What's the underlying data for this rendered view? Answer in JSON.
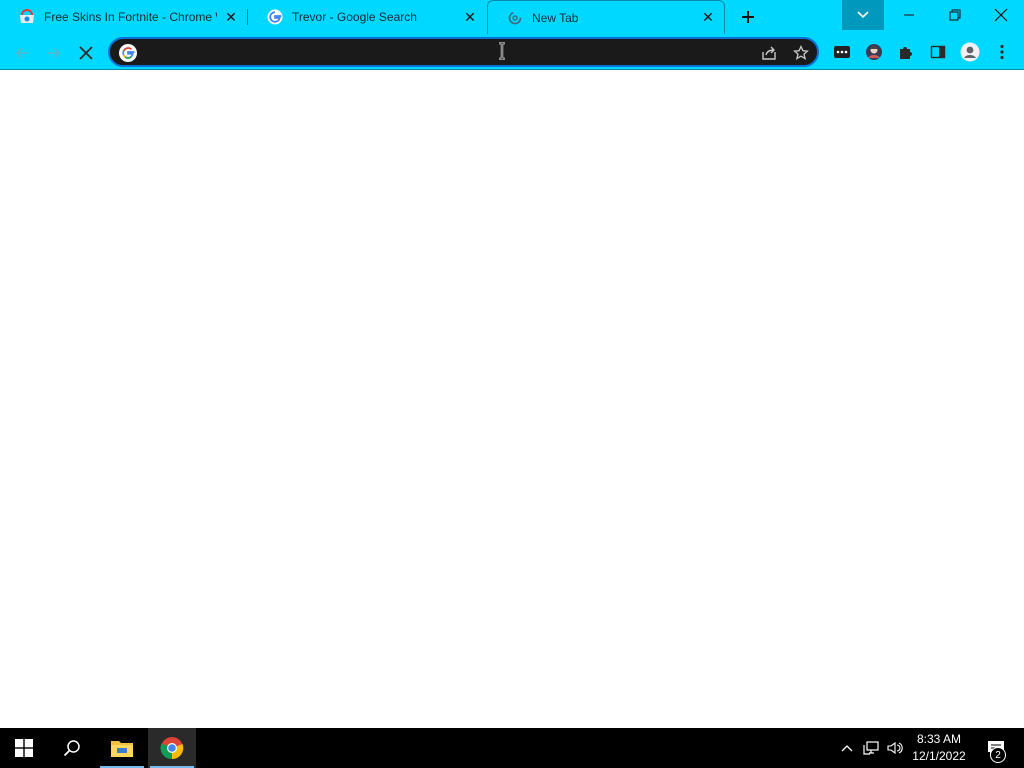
{
  "browser": {
    "tabs": [
      {
        "title": "Free Skins In Fortnite - Chrome Web Store",
        "favicon": "chrome-web-store-icon",
        "active": false
      },
      {
        "title": "Trevor - Google Search",
        "favicon": "google-icon",
        "active": false
      },
      {
        "title": "New Tab",
        "favicon": "loading-spinner-icon",
        "active": true
      }
    ],
    "omnibox": {
      "value": "",
      "placeholder": ""
    },
    "theme_color": "#00d8ff",
    "omnibox_border_color": "#0a6fd6"
  },
  "taskbar": {
    "apps": [
      {
        "name": "file-explorer",
        "icon": "folder-icon"
      },
      {
        "name": "chrome",
        "icon": "chrome-icon",
        "active": true
      }
    ],
    "clock": {
      "time": "8:33 AM",
      "date": "12/1/2022"
    },
    "notifications_count": "2"
  }
}
